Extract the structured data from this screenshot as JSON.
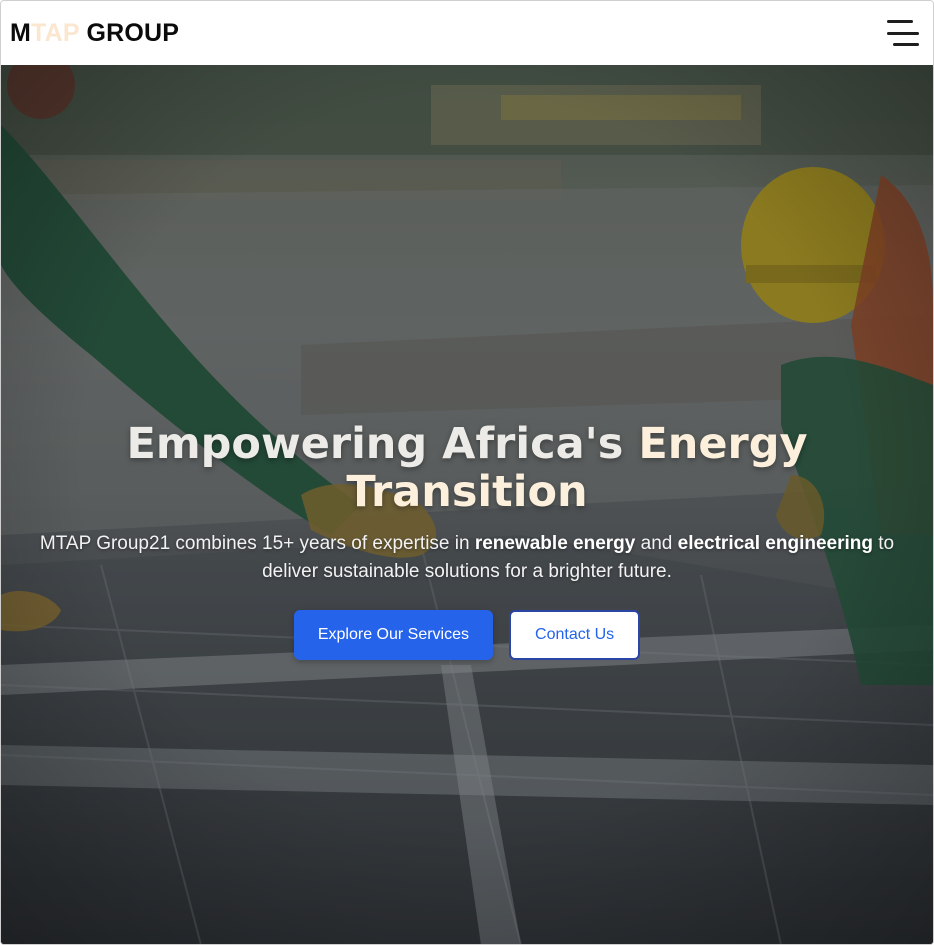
{
  "header": {
    "logo_prefix": "M",
    "logo_accent": "TAP",
    "logo_suffix": " GROUP",
    "menu_icon": "hamburger-menu-icon"
  },
  "hero": {
    "title_part1": "Empowering Africa's ",
    "title_highlight": "Energy",
    "title_part2": "Transition",
    "subtitle_part1": "MTAP Group21 combines 15+ years of expertise in ",
    "subtitle_bold1": "renewable energy",
    "subtitle_part2": " and ",
    "subtitle_bold2": "electrical engineering",
    "subtitle_part3": " to deliver sustainable solutions for a brighter future.",
    "primary_button_label": "Explore Our Services",
    "secondary_button_label": "Contact Us"
  },
  "colors": {
    "brand_blue": "#2563eb",
    "logo_accent": "#fbe6d0",
    "title_highlight": "#fcefdc",
    "overlay": "#3f4447"
  }
}
